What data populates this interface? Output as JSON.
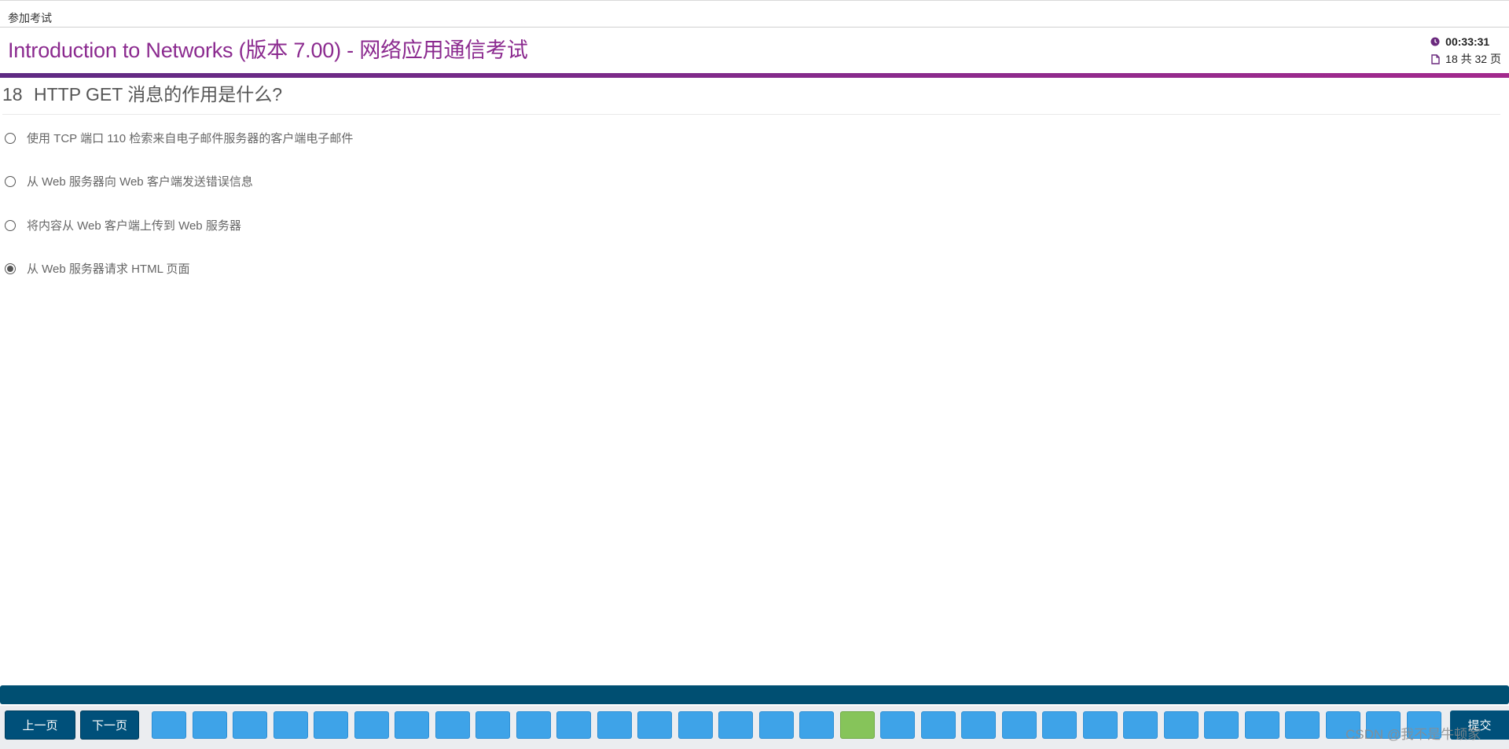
{
  "header": {
    "breadcrumb": "参加考试",
    "title": "Introduction to Networks (版本 7.00) - 网络应用通信考试",
    "timer": "00:33:31",
    "page_indicator": "18 共 32 页"
  },
  "question": {
    "number": "18",
    "text": "HTTP GET 消息的作用是什么?"
  },
  "options": [
    {
      "label": "使用 TCP 端口 110 检索来自电子邮件服务器的客户端电子邮件",
      "selected": false
    },
    {
      "label": "从 Web 服务器向 Web 客户端发送错误信息",
      "selected": false
    },
    {
      "label": "将内容从 Web 客户端上传到 Web 服务器",
      "selected": false
    },
    {
      "label": "从 Web 服务器请求 HTML 页面",
      "selected": true
    }
  ],
  "footer": {
    "prev_label": "上一页",
    "next_label": "下一页",
    "submit_label": "提交",
    "current_question": 18,
    "visible_question_boxes": 32,
    "watermark": "CSDN @我不是牛顿家"
  },
  "colors": {
    "title_purple": "#8b2a8f",
    "nav_dark_blue": "#00507a",
    "question_box_blue": "#3ea3e8",
    "current_box_green": "#86c45a"
  },
  "icons": {
    "timer": "clock-icon",
    "page": "page-icon"
  }
}
